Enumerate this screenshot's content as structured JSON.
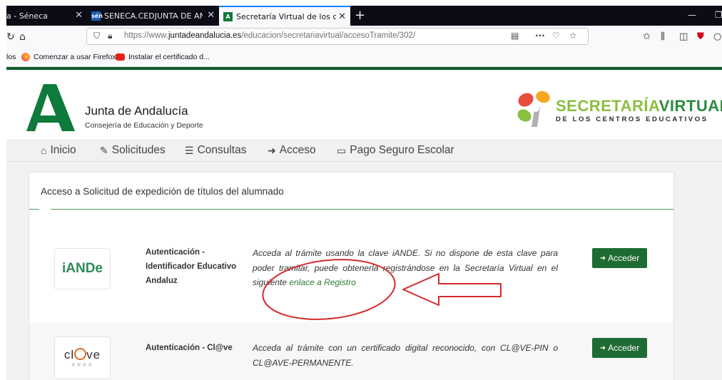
{
  "browser": {
    "tabs": [
      {
        "label": "a - Séneca",
        "active": false
      },
      {
        "label": "SENECA.CEDJUNTA DE ANDA",
        "favicon": "séñ",
        "active": false
      },
      {
        "label": "Secretaría Virtual de los centros",
        "active": true
      }
    ],
    "new_tab": "+",
    "url": {
      "prefix": "https://www.",
      "domain": "juntadeandalucia.es",
      "path": "/educacion/secretariavirtual/accesoTramite/302/"
    },
    "url_menu": "···"
  },
  "bookmarks": [
    {
      "label": "los",
      "icon": "folder-icon"
    },
    {
      "label": "Comenzar a usar Firefox",
      "icon": "firefox-icon"
    },
    {
      "label": "Instalar el certificado d...",
      "icon": "youtube-icon"
    }
  ],
  "header": {
    "brand_title": "Junta de Andalucía",
    "brand_subtitle": "Consejería de Educación y Deporte",
    "sv_word1": "SECRETARÍA",
    "sv_word2": "VIRTUAL",
    "sv_subtitle": "DE LOS CENTROS EDUCATIVOS",
    "colors": {
      "junta_green": "#0e7a3b",
      "sv_light": "#8bbf3f",
      "sv_dark": "#2b8a3e"
    }
  },
  "menu": [
    {
      "label": "Inicio",
      "icon": "home-icon"
    },
    {
      "label": "Solicitudes",
      "icon": "pencil-icon"
    },
    {
      "label": "Consultas",
      "icon": "list-icon"
    },
    {
      "label": "Acceso",
      "icon": "sign-in-icon"
    },
    {
      "label": "Pago Seguro Escolar",
      "icon": "credit-card-icon"
    }
  ],
  "panel": {
    "title": "Acceso a Solicitud de expedición de títulos del alumnado",
    "methods": [
      {
        "logo_text": "iANDe",
        "title_lines": [
          "Autenticación -",
          "Identificador Educativo",
          "Andaluz"
        ],
        "description": "Acceda al trámite usando la clave iANDE. Si no dispone de esta clave para poder tramitar, puede obtenerla registrándose en la Secretaría Virtual en el siguiente ",
        "link": "enlace a Registro",
        "button": "Acceder"
      },
      {
        "logo_text_1": "cl",
        "logo_text_2": "ve",
        "logo_stars": "✱✱✱✱",
        "title_lines": [
          "Autenticación - Cl@ve"
        ],
        "description": "Acceda al trámite con un certificado digital reconocido, con CL@VE-PIN o CL@AVE-PERMANENTE.",
        "button": "Acceder"
      }
    ]
  },
  "annotation_color": "#d42a2a"
}
